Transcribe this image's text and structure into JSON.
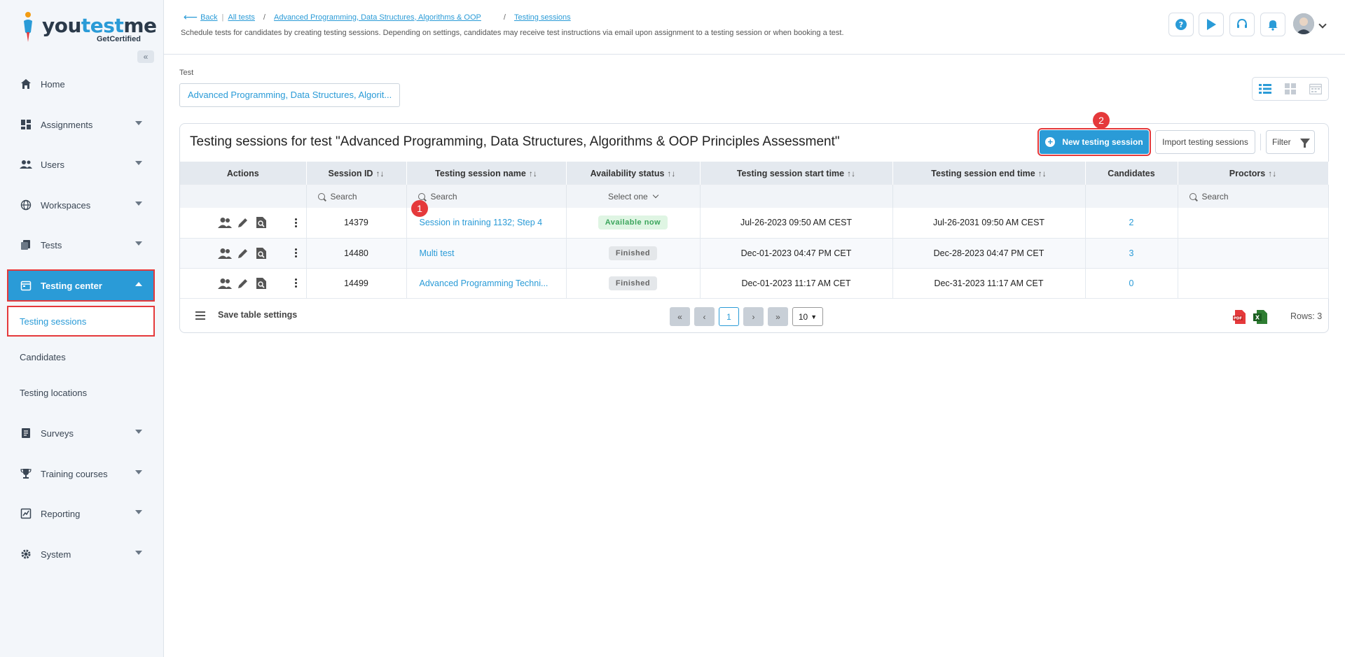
{
  "logo": {
    "text_a": "you",
    "text_b": "test",
    "text_c": "me",
    "sub": "GetCertified"
  },
  "sidebar": {
    "collapse_glyph": "«",
    "items": [
      {
        "label": "Home",
        "icon": "home-icon"
      },
      {
        "label": "Assignments",
        "icon": "dashboard-icon"
      },
      {
        "label": "Users",
        "icon": "users-icon"
      },
      {
        "label": "Workspaces",
        "icon": "globe-icon"
      },
      {
        "label": "Tests",
        "icon": "tests-icon"
      },
      {
        "label": "Testing center",
        "icon": "calendar-icon"
      },
      {
        "label": "Surveys",
        "icon": "survey-icon"
      },
      {
        "label": "Training courses",
        "icon": "trophy-icon"
      },
      {
        "label": "Reporting",
        "icon": "report-icon"
      },
      {
        "label": "System",
        "icon": "gear-icon"
      }
    ],
    "sub_items": [
      {
        "label": "Testing sessions"
      },
      {
        "label": "Candidates"
      },
      {
        "label": "Testing locations"
      }
    ]
  },
  "header": {
    "back": "Back",
    "crumbs": [
      "All tests",
      "Advanced Programming, Data Structures, Algorithms & OOP",
      "Testing sessions"
    ],
    "sep": "/",
    "description": "Schedule tests for candidates by creating testing sessions. Depending on settings, candidates may receive test instructions via email upon assignment to a testing session or when booking a test."
  },
  "test_selector": {
    "label": "Test",
    "value": "Advanced Programming, Data Structures, Algorit..."
  },
  "panel": {
    "title": "Testing sessions for test \"Advanced Programming, Data Structures, Algorithms & OOP Principles Assessment\"",
    "new_button": "New testing session",
    "import_button": "Import testing sessions",
    "filter_button": "Filter",
    "badge_1": "1",
    "badge_2": "2"
  },
  "table": {
    "sort_glyph": "↑↓",
    "columns": [
      "Actions",
      "Session ID",
      "Testing session name",
      "Availability status",
      "Testing session start time",
      "Testing session end time",
      "Candidates",
      "Proctors"
    ],
    "search_placeholder": "Search",
    "select_placeholder": "Select one",
    "rows": [
      {
        "id": "14379",
        "name": "Session in training 1132; Step 4",
        "status": "Available now",
        "start": "Jul-26-2023 09:50 AM CEST",
        "end": "Jul-26-2031 09:50 AM CEST",
        "candidates": "2"
      },
      {
        "id": "14480",
        "name": "Multi test",
        "status": "Finished",
        "start": "Dec-01-2023 04:47 PM CET",
        "end": "Dec-28-2023 04:47 PM CET",
        "candidates": "3"
      },
      {
        "id": "14499",
        "name": "Advanced Programming Techni...",
        "status": "Finished",
        "start": "Dec-01-2023 11:17 AM CET",
        "end": "Dec-31-2023 11:17 AM CET",
        "candidates": "0"
      }
    ]
  },
  "footer": {
    "save_settings": "Save table settings",
    "current_page": "1",
    "page_size": "10",
    "rows_count": "Rows: 3"
  },
  "colors": {
    "accent": "#2a9bd7",
    "highlight": "#e5393b",
    "available": "#3ba55c"
  }
}
